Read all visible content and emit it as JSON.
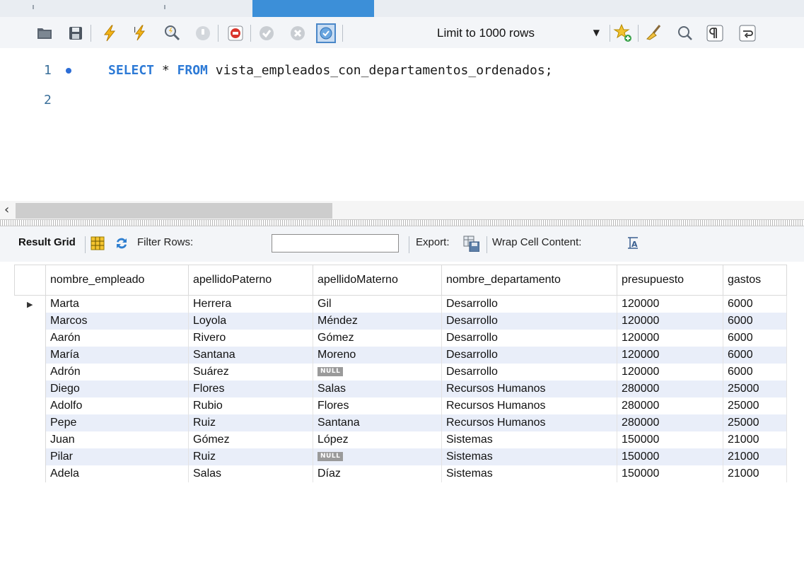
{
  "sql_toolbar": {
    "limit_value": "Limit to 1000 rows"
  },
  "editor": {
    "lines": [
      {
        "number": "1",
        "keyword_select": "SELECT",
        "star": " * ",
        "keyword_from": "FROM",
        "rest": " vista_empleados_con_departamentos_ordenados;"
      },
      {
        "number": "2"
      }
    ]
  },
  "result_toolbar": {
    "result_grid_label": "Result Grid",
    "filter_rows_label": "Filter Rows:",
    "filter_value": "",
    "export_label": "Export:",
    "wrap_cell_label": "Wrap Cell Content:"
  },
  "grid": {
    "columns": [
      "nombre_empleado",
      "apellidoPaterno",
      "apellidoMaterno",
      "nombre_departamento",
      "presupuesto",
      "gastos"
    ],
    "null_label": "NULL",
    "current_row_marker": "▶",
    "rows": [
      [
        "Marta",
        "Herrera",
        "Gil",
        "Desarrollo",
        "120000",
        "6000"
      ],
      [
        "Marcos",
        "Loyola",
        "Méndez",
        "Desarrollo",
        "120000",
        "6000"
      ],
      [
        "Aarón",
        "Rivero",
        "Gómez",
        "Desarrollo",
        "120000",
        "6000"
      ],
      [
        "María",
        "Santana",
        "Moreno",
        "Desarrollo",
        "120000",
        "6000"
      ],
      [
        "Adrón",
        "Suárez",
        null,
        "Desarrollo",
        "120000",
        "6000"
      ],
      [
        "Diego",
        "Flores",
        "Salas",
        "Recursos Humanos",
        "280000",
        "25000"
      ],
      [
        "Adolfo",
        "Rubio",
        "Flores",
        "Recursos Humanos",
        "280000",
        "25000"
      ],
      [
        "Pepe",
        "Ruiz",
        "Santana",
        "Recursos Humanos",
        "280000",
        "25000"
      ],
      [
        "Juan",
        "Gómez",
        "López",
        "Sistemas",
        "150000",
        "21000"
      ],
      [
        "Pilar",
        "Ruiz",
        null,
        "Sistemas",
        "150000",
        "21000"
      ],
      [
        "Adela",
        "Salas",
        "Díaz",
        "Sistemas",
        "150000",
        "21000"
      ]
    ]
  },
  "colors": {
    "keyword": "#2d7ad6",
    "row_stripe": "#e9eef9",
    "active_tab": "#3c8fd8"
  }
}
